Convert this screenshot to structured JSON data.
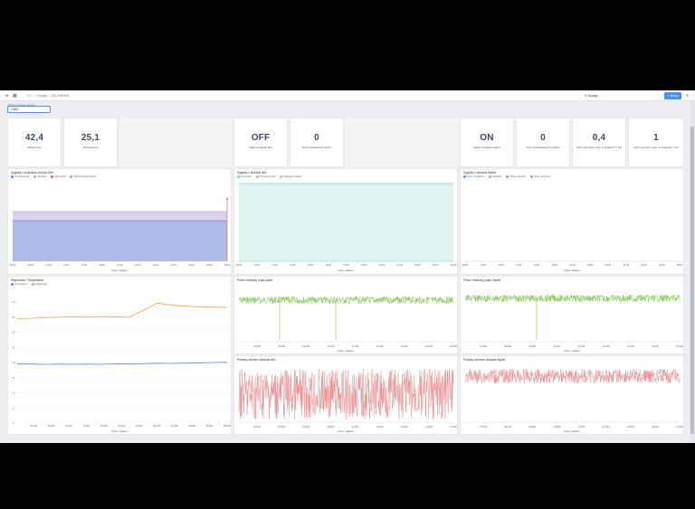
{
  "topbar": {
    "crumb": "/// / ... / Zapisy ... ARCHIWUM",
    "search_placeholder": "Szukaj...",
    "new_label": "+ Nowy"
  },
  "variable": {
    "label": "Wybór Mogulu zaworu",
    "value": "1980"
  },
  "stats": [
    {
      "value": "42,4",
      "label": "Wilgotność"
    },
    {
      "value": "25,1",
      "label": "Temperatura"
    },
    {
      "value": "OFF",
      "label": "Status drukarki farb"
    },
    {
      "value": "0",
      "label": "Ilość wyłuskanych korku"
    },
    {
      "value": "ON",
      "label": "Status drukarki etykiet"
    },
    {
      "value": "0",
      "label": "Ilość wyłuskiwanych etykiet"
    },
    {
      "value": "0,4",
      "label": "Ilość pobranej masy w ostatnich 7 dni"
    },
    {
      "value": "1",
      "label": "Ilość pobranej masy w ostatnich 7 dni"
    }
  ],
  "x_axis_title": "Czas, zadaru",
  "panels": {
    "p1": {
      "title": "Sygnały z czujników odczytu farb",
      "legend": [
        "Kontrolowanie",
        "Zasilanie",
        "Aktywność",
        "Wolne/przekazywane"
      ],
      "legend_colors": [
        "#6b83d8",
        "#b7a3dc",
        "#e06f5f",
        "#aaaaaa"
      ],
      "xticks": [
        "08:00",
        "10:00",
        "12:00",
        "14:00",
        "16:00",
        "18:00",
        "20:00",
        "22:00",
        "00:00",
        "02:00",
        "04:00",
        "06:00",
        "08:00"
      ]
    },
    "p2": {
      "title": "Sygnały z drukarki farb",
      "legend": [
        "Przerwany",
        "Przerwa z etap",
        "Obsługi po awarii"
      ],
      "legend_colors": [
        "#7fd0c8",
        "#e9a86b",
        "#e0c070"
      ],
      "xticks": [
        "08:00",
        "10:00",
        "12:00",
        "14:00",
        "16:00",
        "18:00",
        "20:00",
        "22:00",
        "00:00",
        "02:00",
        "04:00",
        "06:00",
        "08:00"
      ]
    },
    "p3": {
      "title": "Sygnały z drukarki etykiet",
      "legend": [
        "Stany na głowicy",
        "Zasilanie",
        "Wolne zasobne",
        "Stany na sensor"
      ],
      "legend_colors": [
        "#5a8fe0",
        "#e9a86b",
        "#6bc072",
        "#aaaaaa"
      ],
      "xticks": [
        "08:00",
        "10:00",
        "12:00",
        "14:00",
        "16:00",
        "18:00",
        "20:00",
        "22:00",
        "00:00",
        "02:00",
        "04:00",
        "06:00",
        "08:00"
      ]
    },
    "p4": {
      "title": "Wilgotność i Temperatura",
      "legend": [
        "Temperatura",
        "Wilgotność"
      ],
      "legend_colors": [
        "#5a8fe0",
        "#f0a24a"
      ],
      "yticks": [
        "40",
        "35",
        "30",
        "25",
        "20",
        "15",
        "10",
        "5",
        "0"
      ],
      "xticks": [
        "10:000",
        "12:000",
        "14:000",
        "16:000",
        "18:000",
        "20:000",
        "22:000",
        "00:000",
        "02:000",
        "04:000",
        "06:000",
        "08:000"
      ]
    },
    "p5": {
      "title": "Pobór chwilowy prądu karet",
      "xticks": [
        "07:000",
        "08:000",
        "09:000",
        "10:000",
        "11:000",
        "12:000",
        "13:000",
        "14:000",
        "15:000"
      ]
    },
    "p6": {
      "title": "Pobór chwilowy prądu etykiet",
      "xticks": [
        "07:000",
        "08:000",
        "09:000",
        "10:000",
        "11:000",
        "12:000",
        "13:000",
        "14:000",
        "15:000"
      ]
    },
    "p7": {
      "title": "Pomiary zderzeń drukarki farb",
      "xticks": [
        "07:000",
        "08:000",
        "09:000",
        "10:000",
        "11:000",
        "12:000",
        "13:000",
        "14:000",
        "15:000"
      ]
    },
    "p8": {
      "title": "Pomiary zderzeń drukarki etykiet",
      "xticks": [
        "07:000",
        "08:000",
        "09:000",
        "10:000",
        "11:000",
        "12:000",
        "13:000",
        "14:000",
        "15:000"
      ]
    }
  },
  "colors": {
    "blue_fill": "#aebbe8",
    "purple_fill": "#ddd2ee",
    "red_line": "#e06f5f",
    "teal_fill": "#dff3f1",
    "teal_line": "#7fd0c8",
    "green_line": "#7cc24a",
    "orange_line": "#f0a24a",
    "blue_line": "#5a8fe0",
    "pink_line": "#e98a8a"
  },
  "chart_data": [
    {
      "type": "area",
      "title": "Sygnały z czujników odczytu farb",
      "x": [
        "08:00",
        "10:00",
        "12:00",
        "14:00",
        "16:00",
        "18:00",
        "20:00",
        "22:00",
        "00:00",
        "02:00",
        "04:00",
        "06:00",
        "08:00"
      ],
      "series": [
        {
          "name": "Kontrolowanie",
          "values": [
            1,
            1,
            1,
            1,
            1,
            1,
            1,
            1,
            1,
            1,
            1,
            1,
            1
          ]
        },
        {
          "name": "Zasilanie",
          "values": [
            1.2,
            1.2,
            1.2,
            1.2,
            1.2,
            1.2,
            1.2,
            1.2,
            1.2,
            1.2,
            1.2,
            1.2,
            1.2
          ]
        }
      ]
    },
    {
      "type": "area",
      "title": "Sygnały z drukarki farb",
      "x": [
        "08:00",
        "10:00",
        "12:00",
        "14:00",
        "16:00",
        "18:00",
        "20:00",
        "22:00",
        "00:00",
        "02:00",
        "04:00",
        "06:00",
        "08:00"
      ],
      "series": [
        {
          "name": "Przerwany",
          "values": [
            1,
            1,
            1,
            1,
            1,
            1,
            1,
            1,
            1,
            1,
            1,
            1,
            1
          ]
        }
      ]
    },
    {
      "type": "line",
      "title": "Wilgotność i Temperatura",
      "ylim": [
        0,
        40
      ],
      "series": [
        {
          "name": "Wilgotność",
          "values": [
            34.5,
            34.6,
            34.8,
            35.0,
            35.1,
            35.0,
            35.2,
            35.1,
            35.0,
            37.2,
            39.6,
            39.0,
            38.6,
            38.4,
            38.3,
            38.2
          ]
        },
        {
          "name": "Temperatura",
          "values": [
            19.6,
            19.5,
            19.4,
            19.5,
            19.4,
            19.5,
            19.4,
            19.6,
            19.5,
            19.6,
            19.8,
            19.7,
            19.8,
            19.9,
            20.0,
            20.1
          ]
        }
      ]
    }
  ]
}
